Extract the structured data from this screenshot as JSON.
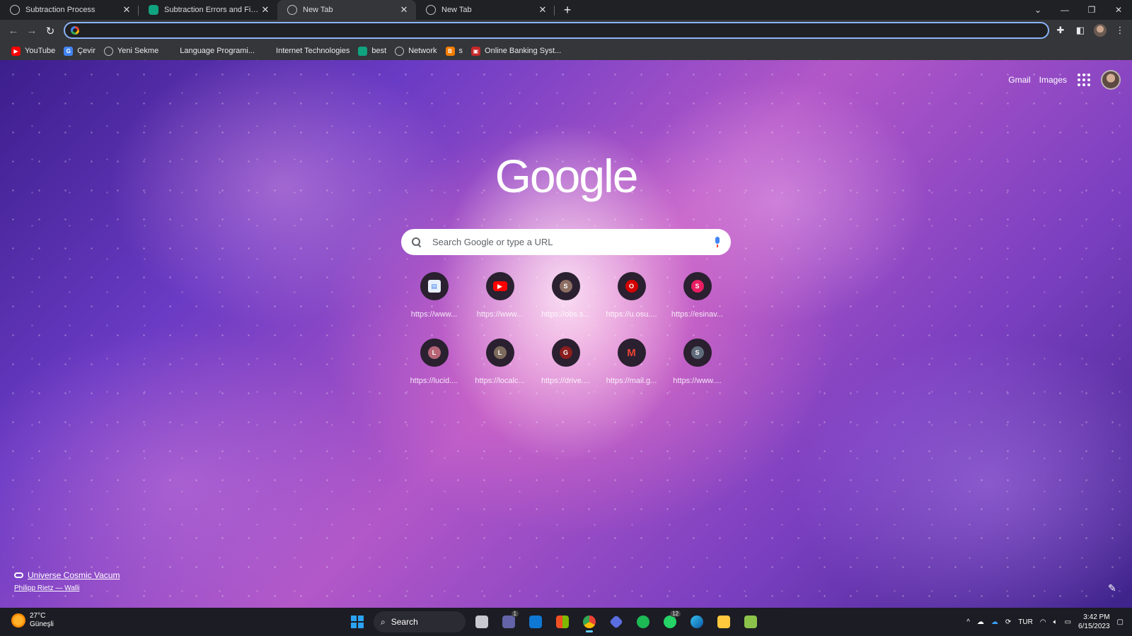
{
  "tabs": [
    {
      "title": "Subtraction Process",
      "favicon": "globe-icon"
    },
    {
      "title": "Subtraction Errors and Fixes",
      "favicon": "chatgpt-icon"
    },
    {
      "title": "New Tab",
      "favicon": "chrome-icon",
      "active": true
    },
    {
      "title": "New Tab",
      "favicon": "chrome-icon"
    }
  ],
  "bookmarks": [
    {
      "label": "YouTube",
      "icon": "youtube-icon",
      "color": "#ff0000"
    },
    {
      "label": "Çevir",
      "icon": "translate-icon",
      "color": "#4285f4"
    },
    {
      "label": "Yeni Sekme",
      "icon": "globe-icon",
      "color": "#9aa0a6"
    },
    {
      "label": "Language Programi...",
      "icon": "",
      "color": ""
    },
    {
      "label": "Internet Technologies",
      "icon": "",
      "color": ""
    },
    {
      "label": "best",
      "icon": "chatgpt-icon",
      "color": "#10a37f"
    },
    {
      "label": "Network",
      "icon": "globe-icon",
      "color": "#9aa0a6"
    },
    {
      "label": "s",
      "icon": "blogger-icon",
      "color": "#f57d00"
    },
    {
      "label": "Online Banking Syst...",
      "icon": "bank-icon",
      "color": "#c62828"
    }
  ],
  "toplinks": {
    "gmail": "Gmail",
    "images": "Images"
  },
  "logo": "Google",
  "search": {
    "placeholder": "Search Google or type a URL"
  },
  "shortcuts": [
    {
      "label": "https://www...",
      "letter": "",
      "color": "#e8f0fe",
      "icon": "docs-icon"
    },
    {
      "label": "https://www...",
      "letter": "▶",
      "color": "#ff0000",
      "icon": "youtube-icon"
    },
    {
      "label": "https://obs.s...",
      "letter": "S",
      "color": "#8d6e63",
      "icon": "letter-icon"
    },
    {
      "label": "https://u.osu....",
      "letter": "O",
      "color": "#d50000",
      "icon": "letter-icon"
    },
    {
      "label": "https://esinav...",
      "letter": "S",
      "color": "#e91e63",
      "icon": "letter-icon"
    },
    {
      "label": "https://lucid....",
      "letter": "L",
      "color": "#b56576",
      "icon": "letter-icon"
    },
    {
      "label": "https://localc...",
      "letter": "L",
      "color": "#7d6b5d",
      "icon": "letter-icon"
    },
    {
      "label": "https://drive....",
      "letter": "G",
      "color": "#8b1e1e",
      "icon": "letter-icon"
    },
    {
      "label": "https://mail.g...",
      "letter": "M",
      "color": "#ea4335",
      "icon": "gmail-icon"
    },
    {
      "label": "https://www....",
      "letter": "S",
      "color": "#5f6b7a",
      "icon": "letter-icon"
    }
  ],
  "attribution": {
    "title": "Universe Cosmic Vacum",
    "author": "Philipp Rietz — Walli"
  },
  "taskbar": {
    "weather_temp": "27°C",
    "weather_desc": "Güneşli",
    "search_label": "Search",
    "language": "TUR",
    "time": "3:42 PM",
    "date": "6/15/2023",
    "teams_badge": "1",
    "whatsapp_badge": "12"
  }
}
